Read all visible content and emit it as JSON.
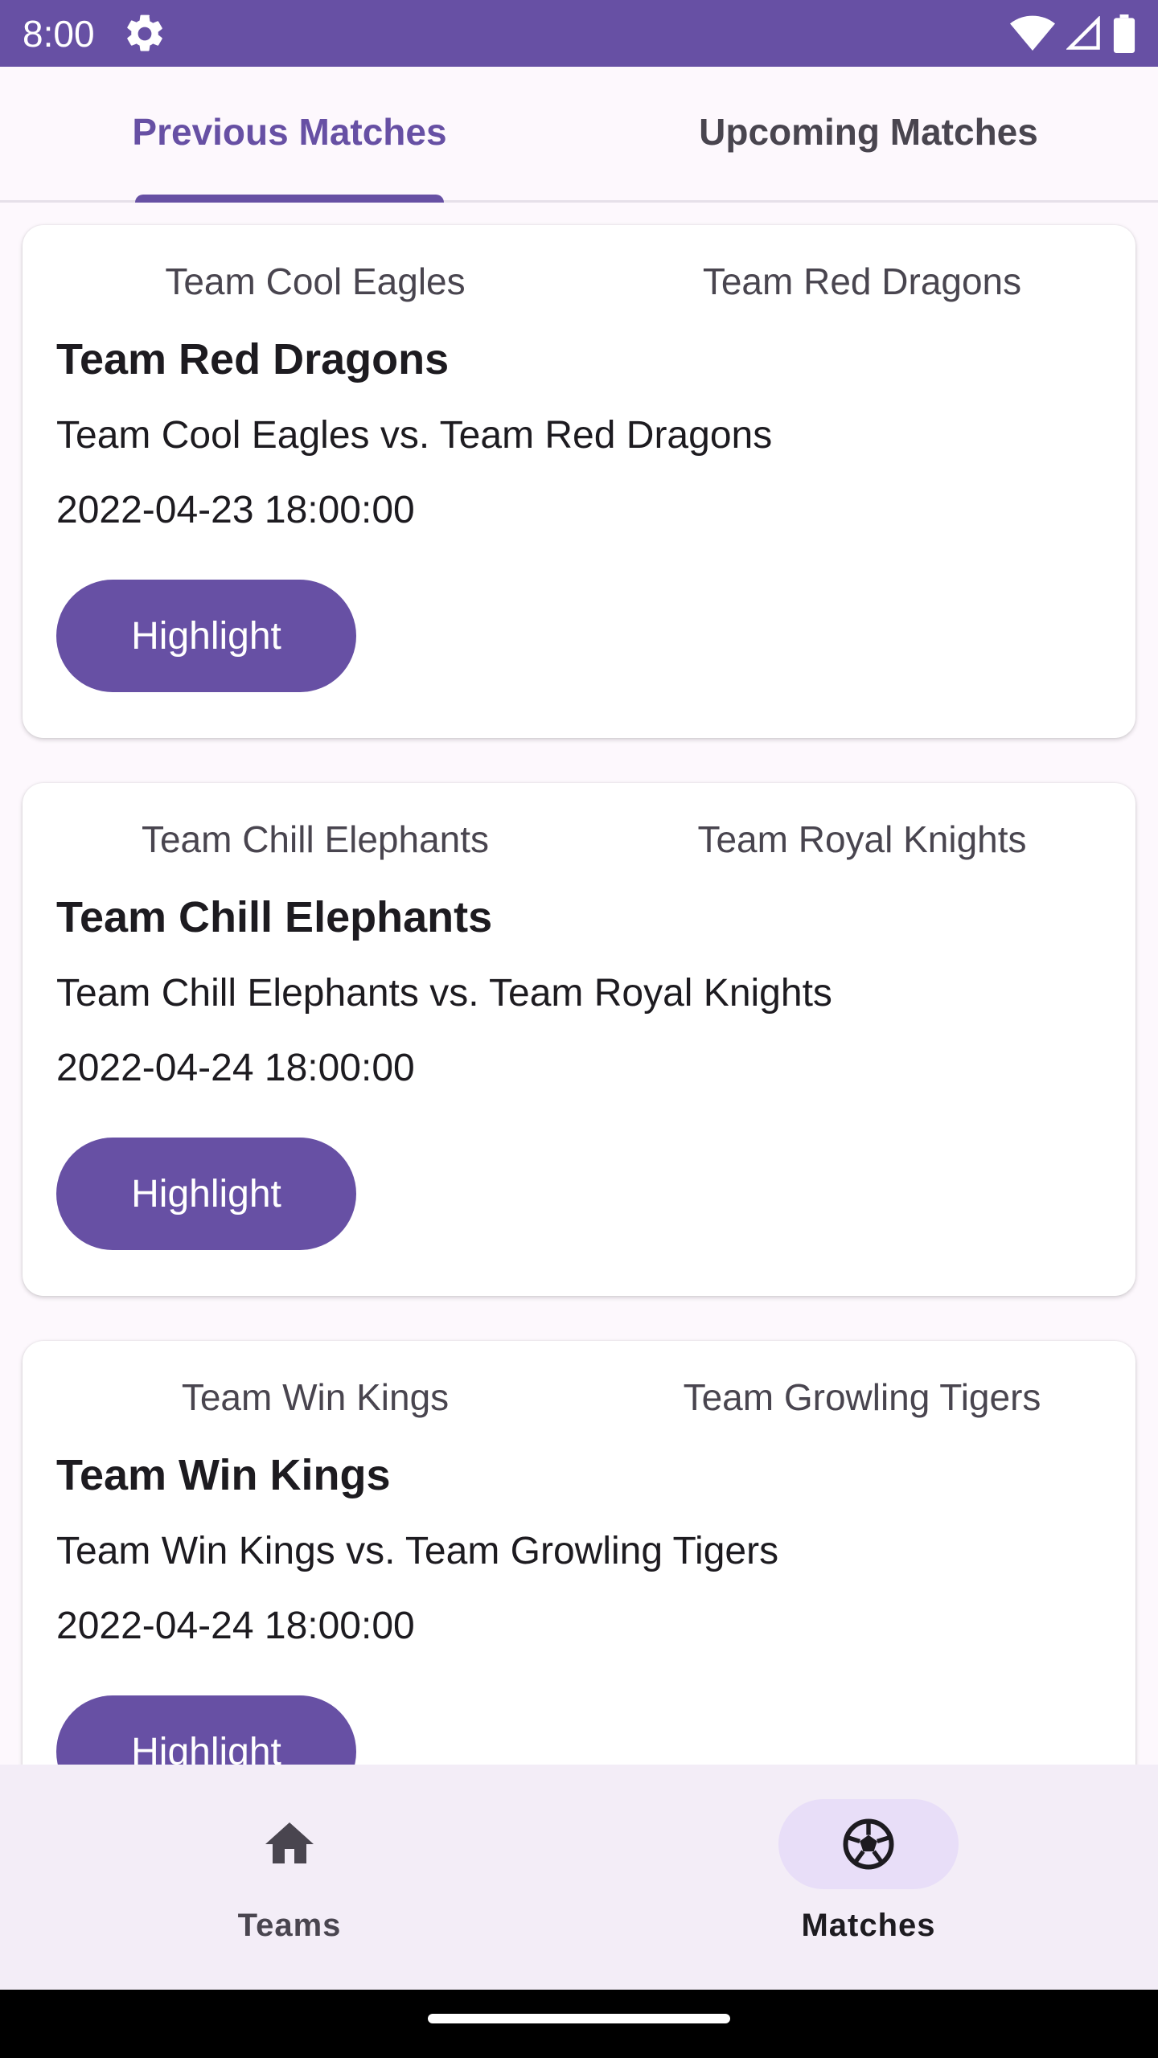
{
  "status_bar": {
    "time": "8:00",
    "icons": [
      "settings-gear-icon",
      "wifi-icon",
      "cell-signal-icon",
      "battery-icon"
    ]
  },
  "tabs": [
    {
      "label": "Previous Matches",
      "selected": true
    },
    {
      "label": "Upcoming Matches",
      "selected": false
    }
  ],
  "matches": [
    {
      "home_team": "Team Cool Eagles",
      "away_team": "Team Red Dragons",
      "winner": "Team Red Dragons",
      "description": "Team Cool Eagles vs. Team Red Dragons",
      "date": "2022-04-23 18:00:00",
      "button_label": "Highlight"
    },
    {
      "home_team": "Team Chill Elephants",
      "away_team": "Team Royal Knights",
      "winner": "Team Chill Elephants",
      "description": "Team Chill Elephants vs. Team Royal Knights",
      "date": "2022-04-24 18:00:00",
      "button_label": "Highlight"
    },
    {
      "home_team": "Team Win Kings",
      "away_team": "Team Growling Tigers",
      "winner": "Team Win Kings",
      "description": "Team Win Kings vs. Team Growling Tigers",
      "date": "2022-04-24 18:00:00",
      "button_label": "Highlight"
    }
  ],
  "bottom_nav": {
    "items": [
      {
        "label": "Teams",
        "icon": "home-icon",
        "selected": false
      },
      {
        "label": "Matches",
        "icon": "soccer-ball-icon",
        "selected": true
      }
    ]
  },
  "colors": {
    "primary": "#6750a4",
    "nav_indicator": "#e8def8",
    "surface": "#fdf8fd"
  }
}
